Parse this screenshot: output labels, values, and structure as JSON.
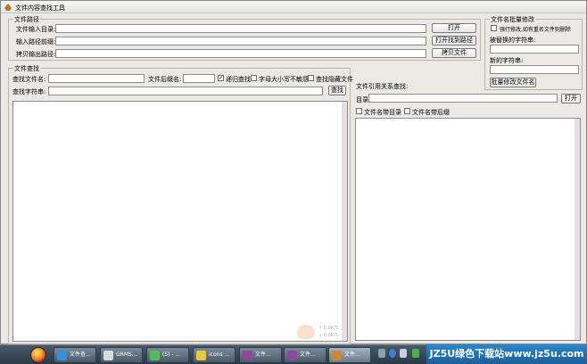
{
  "window": {
    "title": "文件内容查找工具"
  },
  "paths_group": {
    "legend": "文件路径",
    "input_dir_label": "文件输入目录:",
    "input_dir_value": "",
    "input_path_label": "输入路径前缀:",
    "input_path_value": "",
    "copy_out_label": "拷贝输出路径:",
    "copy_out_value": "",
    "open_button": "打开",
    "open_output_button": "打开找到路径",
    "copy_file_button": "拷贝文件"
  },
  "rename_group": {
    "legend": "文件名批量修改",
    "force_checkbox_label": "强行修改,如有重名文件则删除",
    "force_checked": false,
    "replace_label": "被替换的字符串:",
    "replace_value": "",
    "new_label": "新的字符串:",
    "new_value": "",
    "rename_button": "批量修改文件名"
  },
  "search_group": {
    "legend": "文件查找",
    "find_name_label": "查找文件名:",
    "find_name_value": "",
    "suffix_label": "文件后缀名:",
    "suffix_value": "",
    "recursive_label": "递归查找",
    "recursive_checked": true,
    "case_label": "字母大小写不敏感",
    "case_checked": false,
    "hidden_label": "查找隐藏文件",
    "hidden_checked": false,
    "find_text_label": "查找字符串:",
    "find_text_value": "",
    "find_button": "查找"
  },
  "ref_group": {
    "title": "文件引用关系查找:",
    "dir_label": "目录:",
    "dir_value": "",
    "open_button": "打开",
    "with_dir_label": "文件名带目录",
    "with_dir_checked": false,
    "with_suffix_label": "文件名带后缀",
    "with_suffix_checked": false
  },
  "watermark": {
    "line1": "↑ 0.0K/S",
    "line2": "↓ 0.0K/S"
  },
  "taskbar": {
    "items": [
      {
        "label": "文件查...",
        "icon": "ie-icon",
        "color": "#3a8ed8"
      },
      {
        "label": "GRMS...",
        "icon": "app-icon",
        "color": "#d9d9d9"
      },
      {
        "label": "(5) - ...",
        "icon": "qq-icon",
        "color": "#5bb55b"
      },
      {
        "label": "icons ...",
        "icon": "folder-icon",
        "color": "#e8c64a"
      },
      {
        "label": "文件...",
        "icon": "winrar-icon",
        "color": "#8a4a9a"
      },
      {
        "label": "文件...",
        "icon": "winrar-icon",
        "color": "#8a4a9a"
      },
      {
        "label": "文件...",
        "icon": "tool-icon",
        "color": "#c58a3a"
      }
    ],
    "brand": "JZ5U绿色下载站www.jz5u.com"
  }
}
